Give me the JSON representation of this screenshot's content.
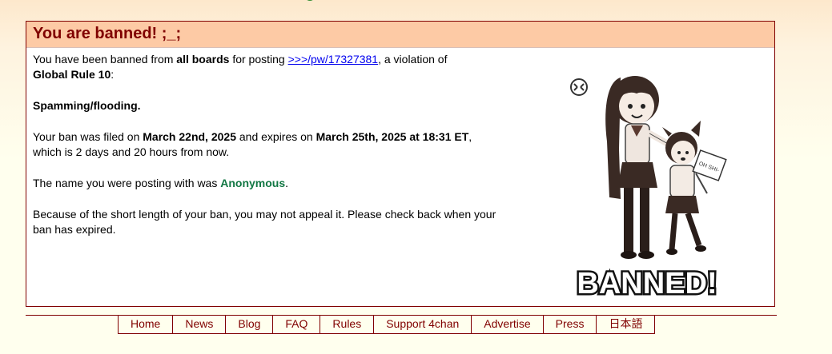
{
  "header": {
    "title": "You are banned! ;_;"
  },
  "ban": {
    "line1_prefix": "You have been banned from ",
    "scope": "all boards",
    "line1_mid": " for posting ",
    "post_link": ">>>/pw/17327381",
    "line1_suffix": ", a violation of",
    "rule": "Global Rule 10",
    "rule_suffix": ":",
    "reason": "Spamming/flooding.",
    "filed_prefix": "Your ban was filed on ",
    "filed_date": "March 22nd, 2025",
    "expires_mid": " and expires on ",
    "expires_date": "March 25th, 2025 at 18:31 ET",
    "expires_suffix": ",",
    "remaining": "which is 2 days and 20 hours from now.",
    "name_prefix": "The name you were posting with was ",
    "name": "Anonymous",
    "name_suffix": ".",
    "appeal_text": "Because of the short length of your ban, you may not appeal it. Please check back when your ban has expired.",
    "image_caption": "BANNED!",
    "image_sign_text": "OH SHI-"
  },
  "footer": {
    "links": [
      "Home",
      "News",
      "Blog",
      "FAQ",
      "Rules",
      "Support 4chan",
      "Advertise",
      "Press",
      "日本語"
    ]
  },
  "colors": {
    "header_bg": "#fdcaa5",
    "title": "#800000",
    "name": "#117743",
    "link": "#0000ee"
  }
}
